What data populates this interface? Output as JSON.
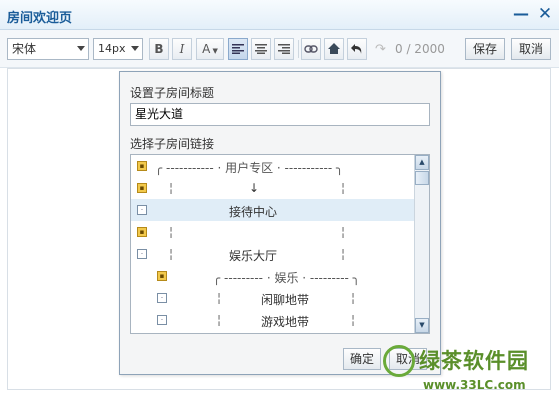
{
  "window": {
    "title": "房间欢迎页",
    "minimize_icon": "minimize-icon",
    "close_icon": "close-icon"
  },
  "toolbar": {
    "font_family": "宋体",
    "font_size": "14px",
    "bold_label": "B",
    "italic_label": "I",
    "color_label": "A",
    "char_counter": "0 / 2000",
    "save_label": "保存",
    "cancel_label": "取消"
  },
  "dialog": {
    "title_label": "设置子房间标题",
    "title_value": "星光大道",
    "link_label": "选择子房间链接",
    "items": [
      {
        "icon": "lock",
        "text": "╭ ----------- · 用户专区 · ----------- ╮"
      },
      {
        "icon": "lock",
        "text": "↓"
      },
      {
        "icon": "dot",
        "text": "接待中心"
      },
      {
        "icon": "lock",
        "text": ""
      },
      {
        "icon": "dot",
        "text": "娱乐大厅"
      },
      {
        "icon": "lock",
        "text": "╭ --------- · 娱乐 · --------- ╮"
      },
      {
        "icon": "dot",
        "text": "闲聊地带"
      },
      {
        "icon": "dot",
        "text": "游戏地带"
      }
    ],
    "ok_label": "确定",
    "cancel_label": "取消"
  },
  "watermark": {
    "brand": "绿茶软件园",
    "url": "www.33LC.com"
  }
}
